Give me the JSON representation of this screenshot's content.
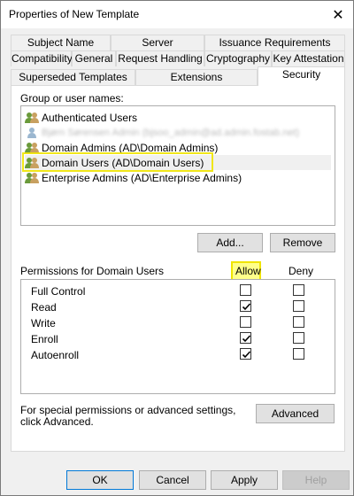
{
  "window": {
    "title": "Properties of New Template",
    "close_glyph": "✕"
  },
  "tabs": {
    "row1": [
      "Subject Name",
      "Server",
      "Issuance Requirements"
    ],
    "row2": [
      "Compatibility",
      "General",
      "Request Handling",
      "Cryptography",
      "Key Attestation"
    ],
    "row3": [
      "Superseded Templates",
      "Extensions",
      "Security"
    ],
    "active": "Security"
  },
  "security": {
    "group_label": "Group or user names:",
    "users": [
      {
        "name": "Authenticated Users",
        "redacted": false,
        "selected": false
      },
      {
        "name": "Bjørn Sørensen Admin (bjsoo_admin@ad.admin.fostab.net)",
        "redacted": true,
        "selected": false
      },
      {
        "name": "Domain Admins (AD\\Domain Admins)",
        "redacted": false,
        "selected": false
      },
      {
        "name": "Domain Users (AD\\Domain Users)",
        "redacted": false,
        "selected": true
      },
      {
        "name": "Enterprise Admins (AD\\Enterprise Admins)",
        "redacted": false,
        "selected": false
      }
    ],
    "add_button": "Add...",
    "remove_button": "Remove",
    "permissions_label": "Permissions for Domain Users",
    "allow_header": "Allow",
    "deny_header": "Deny",
    "permissions": [
      {
        "name": "Full Control",
        "allow": false,
        "deny": false
      },
      {
        "name": "Read",
        "allow": true,
        "deny": false
      },
      {
        "name": "Write",
        "allow": false,
        "deny": false
      },
      {
        "name": "Enroll",
        "allow": true,
        "deny": false
      },
      {
        "name": "Autoenroll",
        "allow": true,
        "deny": false
      }
    ],
    "special_text": "For special permissions or advanced settings, click Advanced.",
    "advanced_button": "Advanced"
  },
  "footer": {
    "ok": "OK",
    "cancel": "Cancel",
    "apply": "Apply",
    "help": "Help"
  },
  "colors": {
    "highlight": "#ffff8a",
    "highlight_border": "#f0e400",
    "focus": "#0078d7"
  }
}
